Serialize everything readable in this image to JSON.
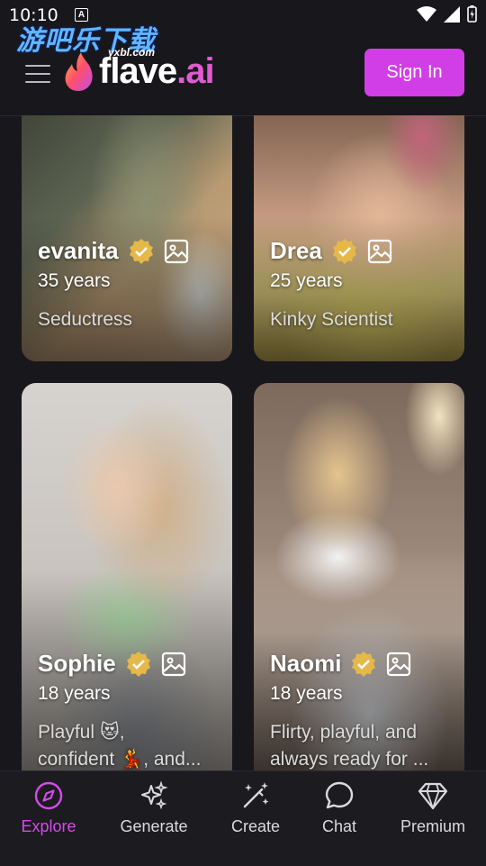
{
  "status": {
    "time": "10:10",
    "indicator": "A"
  },
  "watermark": {
    "main": "游吧乐下载",
    "sub": "yxbl.com"
  },
  "header": {
    "logo_name": "flave",
    "logo_suffix": ".ai",
    "signin_label": "Sign In"
  },
  "colors": {
    "accent": "#d23ee6",
    "background": "#18171c",
    "verified": "#e6b84a"
  },
  "cards": [
    {
      "name": "evanita",
      "age": "35 years",
      "desc": "Seductress"
    },
    {
      "name": "Drea",
      "age": "25 years",
      "desc": "Kinky Scientist"
    },
    {
      "name": "Sophie",
      "age": "18 years",
      "desc": "Playful 😻,\nconfident 💃, and..."
    },
    {
      "name": "Naomi",
      "age": "18 years",
      "desc": "Flirty, playful, and\nalways ready for ..."
    }
  ],
  "nav": [
    {
      "label": "Explore",
      "icon": "compass-icon",
      "active": true
    },
    {
      "label": "Generate",
      "icon": "sparkles-icon",
      "active": false
    },
    {
      "label": "Create",
      "icon": "magic-wand-icon",
      "active": false
    },
    {
      "label": "Chat",
      "icon": "chat-bubble-icon",
      "active": false
    },
    {
      "label": "Premium",
      "icon": "diamond-icon",
      "active": false
    }
  ]
}
